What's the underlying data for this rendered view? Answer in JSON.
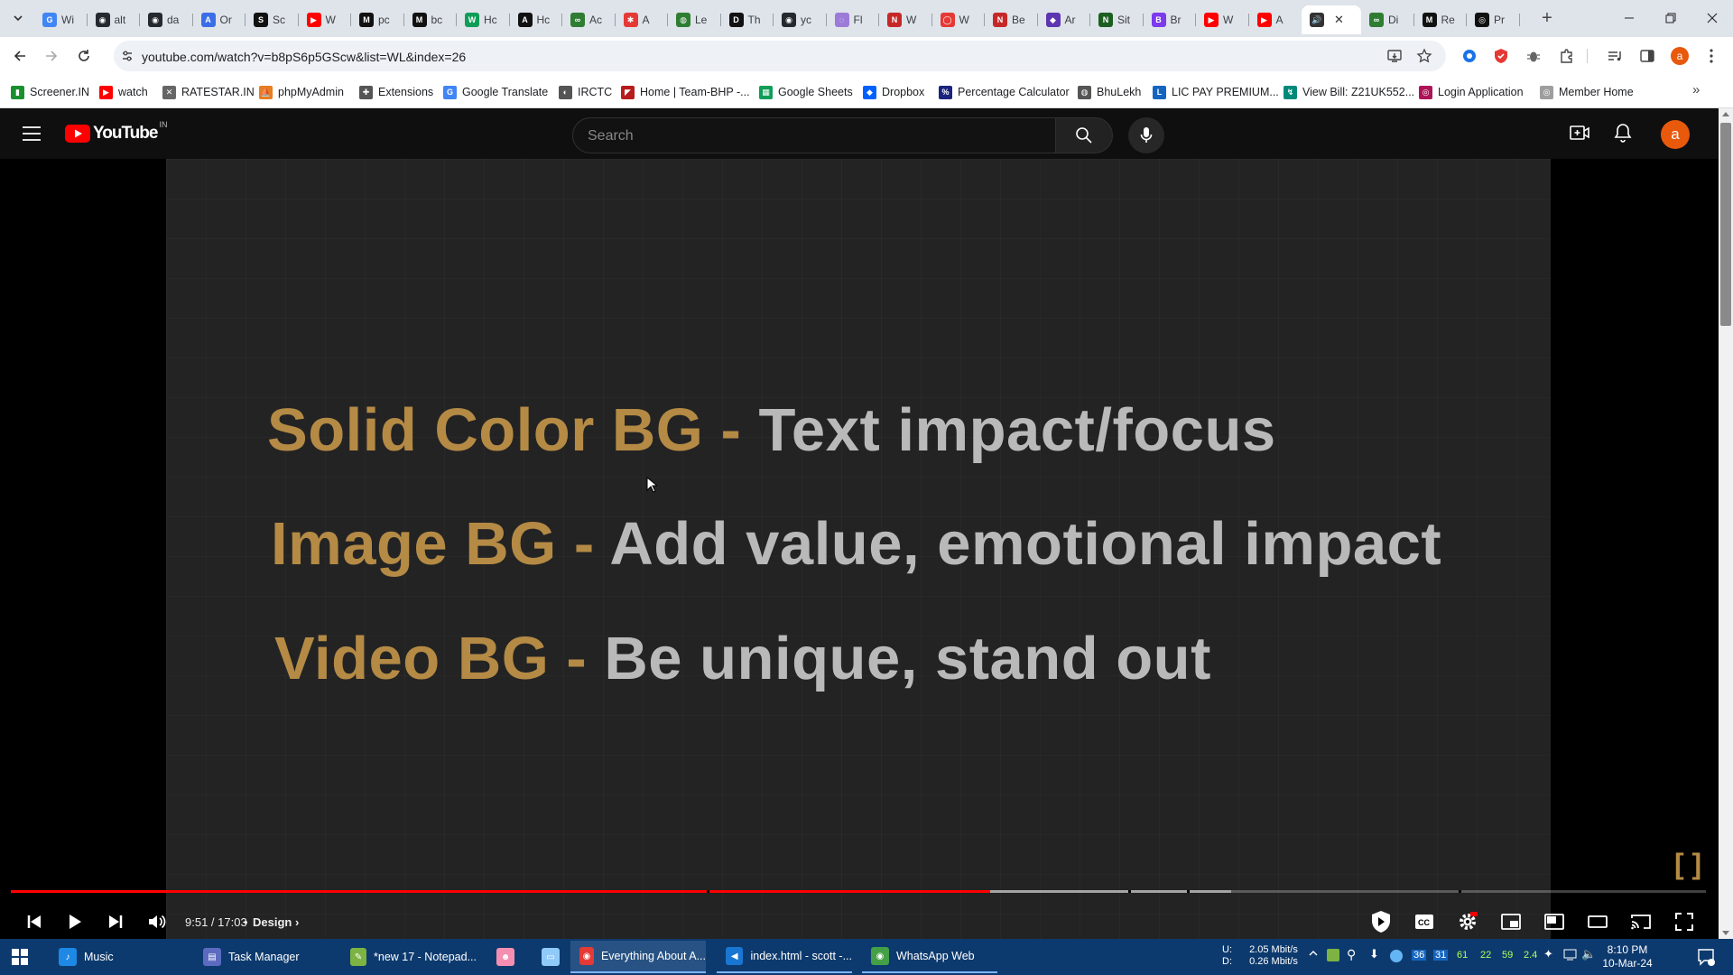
{
  "browser": {
    "tabs": [
      {
        "label": "Wi",
        "color": "#4285f4",
        "glyph": "G"
      },
      {
        "label": "alt",
        "color": "#24292f",
        "glyph": "◉"
      },
      {
        "label": "da",
        "color": "#24292f",
        "glyph": "◉"
      },
      {
        "label": "Or",
        "color": "#3a6ee8",
        "glyph": "A"
      },
      {
        "label": "Sc",
        "color": "#111111",
        "glyph": "S"
      },
      {
        "label": "W",
        "color": "#ff0000",
        "glyph": "▶"
      },
      {
        "label": "pc",
        "color": "#111111",
        "glyph": "M"
      },
      {
        "label": "bc",
        "color": "#111111",
        "glyph": "M"
      },
      {
        "label": "Hc",
        "color": "#0f9d58",
        "glyph": "W"
      },
      {
        "label": "Hc",
        "color": "#111111",
        "glyph": "A"
      },
      {
        "label": "Ac",
        "color": "#2e7d32",
        "glyph": "∞"
      },
      {
        "label": "A",
        "color": "#e53935",
        "glyph": "✱"
      },
      {
        "label": "Le",
        "color": "#2e7d32",
        "glyph": "◍"
      },
      {
        "label": "Th",
        "color": "#111111",
        "glyph": "D"
      },
      {
        "label": "yc",
        "color": "#24292f",
        "glyph": "◉"
      },
      {
        "label": "Fl",
        "color": "#9c7bd8",
        "glyph": "◌"
      },
      {
        "label": "W",
        "color": "#c62828",
        "glyph": "N"
      },
      {
        "label": "W",
        "color": "#e53935",
        "glyph": "◯"
      },
      {
        "label": "Be",
        "color": "#c62828",
        "glyph": "N"
      },
      {
        "label": "Ar",
        "color": "#5e35b1",
        "glyph": "◆"
      },
      {
        "label": "Sit",
        "color": "#1b5e20",
        "glyph": "N"
      },
      {
        "label": "Br",
        "color": "#7c3aed",
        "glyph": "B"
      },
      {
        "label": "W",
        "color": "#ff0000",
        "glyph": "▶"
      },
      {
        "label": "A",
        "color": "#ff0000",
        "glyph": "▶"
      },
      {
        "label": "",
        "color": "#333333",
        "glyph": "🔊",
        "active": true
      },
      {
        "label": "Di",
        "color": "#2e7d32",
        "glyph": "∞"
      },
      {
        "label": "Re",
        "color": "#111111",
        "glyph": "M"
      },
      {
        "label": "Pr",
        "color": "#111111",
        "glyph": "◎"
      }
    ],
    "url": "youtube.com/watch?v=b8pS6p5GScw&list=WL&index=26",
    "bookmarks": [
      {
        "label": "Screener.IN",
        "color": "#1a8f2e",
        "glyph": "▮"
      },
      {
        "label": "watch",
        "color": "#ff0000",
        "glyph": "▶"
      },
      {
        "label": "RATESTAR.IN",
        "color": "#666666",
        "glyph": "✕"
      },
      {
        "label": "phpMyAdmin",
        "color": "#e67e22",
        "glyph": "⛵"
      },
      {
        "label": "Extensions",
        "color": "#555555",
        "glyph": "✚"
      },
      {
        "label": "Google Translate",
        "color": "#4285f4",
        "glyph": "G"
      },
      {
        "label": "IRCTC",
        "color": "#555555",
        "glyph": "◐"
      },
      {
        "label": "Home | Team-BHP -...",
        "color": "#b71c1c",
        "glyph": "◤"
      },
      {
        "label": "Google Sheets",
        "color": "#0f9d58",
        "glyph": "▦"
      },
      {
        "label": "Dropbox",
        "color": "#0061ff",
        "glyph": "◆"
      },
      {
        "label": "Percentage Calculator",
        "color": "#1a237e",
        "glyph": "%"
      },
      {
        "label": "BhuLekh",
        "color": "#555555",
        "glyph": "◍"
      },
      {
        "label": "LIC PAY PREMIUM...",
        "color": "#1565c0",
        "glyph": "L"
      },
      {
        "label": "View Bill: Z21UK552...",
        "color": "#00897b",
        "glyph": "↯"
      },
      {
        "label": "Login Application",
        "color": "#ad1457",
        "glyph": "◎"
      },
      {
        "label": "Member Home",
        "color": "#9e9e9e",
        "glyph": "◎"
      }
    ],
    "avatar_letter": "a"
  },
  "youtube": {
    "logo_text": "YouTube",
    "region": "IN",
    "search_placeholder": "Search",
    "avatar_letter": "a"
  },
  "video": {
    "slide": [
      {
        "keyword": "Solid Color BG -",
        "text": " Text impact/focus"
      },
      {
        "keyword": "Image BG -",
        "text": " Add value, emotional impact"
      },
      {
        "keyword": "Video BG -",
        "text": " Be unique, stand out"
      }
    ],
    "corner_mark": "[ ]",
    "current_time": "9:51",
    "duration": "17:03",
    "time_display": "9:51 / 17:03",
    "chapter_separator": "•",
    "chapter": "Design",
    "played_fraction": 0.578,
    "buffered_fraction": 0.72,
    "colors": {
      "played": "#ff0000",
      "accent": "#b48a45",
      "slide_text": "#b9b9b9"
    }
  },
  "taskbar": {
    "apps": [
      {
        "label": "Music",
        "color": "#1e88e5",
        "glyph": "♪"
      },
      {
        "label": "Task Manager",
        "color": "#5c6bc0",
        "glyph": "▤"
      },
      {
        "label": "*new 17 - Notepad...",
        "color": "#7cb342",
        "glyph": "✎"
      },
      {
        "label": "",
        "color": "#f48fb1",
        "glyph": "☻"
      },
      {
        "label": "",
        "color": "#90caf9",
        "glyph": "▭"
      },
      {
        "label": "Everything About A...",
        "color": "#e53935",
        "glyph": "◉",
        "active": true
      },
      {
        "label": "index.html - scott -...",
        "color": "#1976d2",
        "glyph": "◀"
      },
      {
        "label": "WhatsApp Web",
        "color": "#43a047",
        "glyph": "◉"
      }
    ],
    "net_upload_label": "U:",
    "net_upload": "2.05 Mbit/s",
    "net_download_label": "D:",
    "net_download": "0.26 Mbit/s",
    "tray_numbers": [
      "36",
      "31",
      "61",
      "22",
      "59",
      "2.4"
    ],
    "time": "8:10 PM",
    "date": "10-Mar-24"
  }
}
